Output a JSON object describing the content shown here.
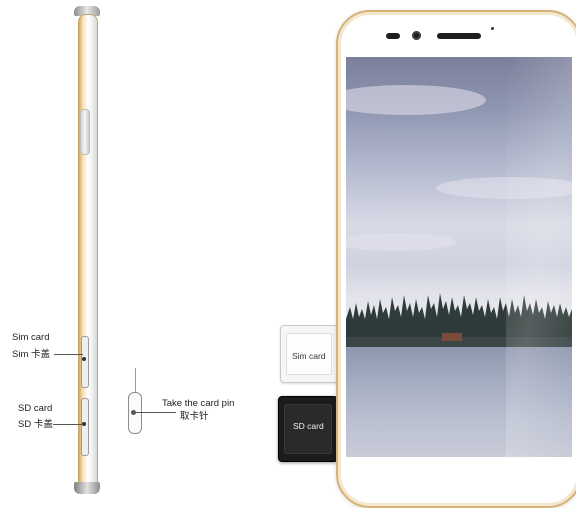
{
  "annotations": {
    "sim_label_en": "Sim card",
    "sim_label_cn": "Sim 卡盖",
    "sd_label_en": "SD card",
    "sd_label_cn": "SD 卡盖",
    "pin_label_en": "Take the card pin",
    "pin_label_cn": "取卡针"
  },
  "trays": {
    "sim_tray_label": "Sim card",
    "sd_tray_label": "SD card"
  },
  "colors": {
    "frame_gold": "#d6b277",
    "sd_tray": "#1c1c1c",
    "sim_tray": "#f6f6f6"
  },
  "icons": [
    "camera-icon",
    "speaker-grille-icon",
    "eject-pin-icon"
  ]
}
